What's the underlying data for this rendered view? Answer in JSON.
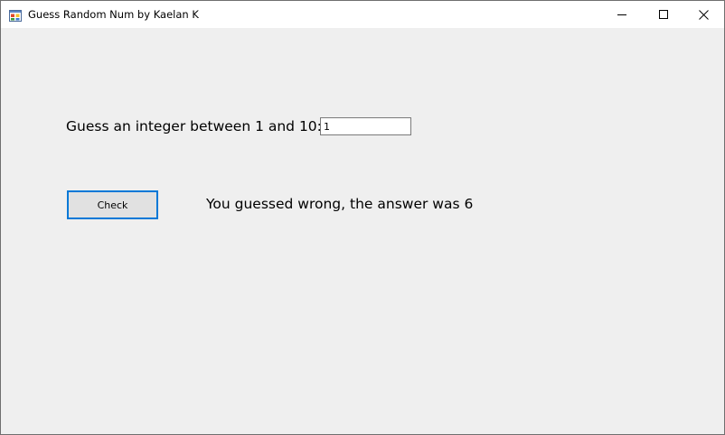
{
  "window": {
    "title": "Guess Random Num by Kaelan K",
    "icon": "winforms-app-icon",
    "controls": {
      "minimize_icon": "minimize-icon",
      "maximize_icon": "maximize-icon",
      "close_icon": "close-icon"
    }
  },
  "form": {
    "prompt_label": "Guess an integer between 1 and 10:",
    "guess_input_value": "1",
    "check_button_label": "Check",
    "result_label": "You guessed wrong, the answer was 6"
  },
  "colors": {
    "focus_border": "#0078d7",
    "client_background": "#efefef",
    "titlebar_background": "#ffffff"
  }
}
